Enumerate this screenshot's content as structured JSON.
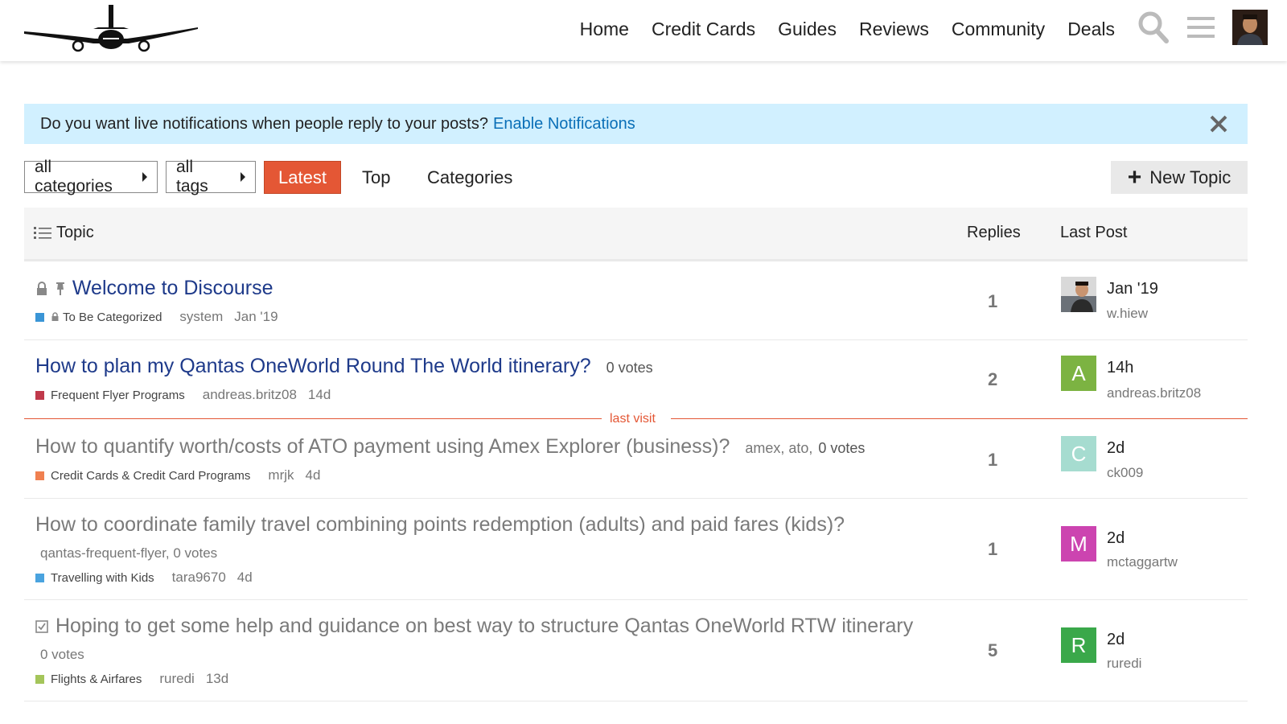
{
  "header": {
    "nav": [
      "Home",
      "Credit Cards",
      "Guides",
      "Reviews",
      "Community",
      "Deals"
    ],
    "icons": [
      "search-icon",
      "hamburger-menu-icon",
      "user-avatar"
    ]
  },
  "banner": {
    "text": "Do you want live notifications when people reply to your posts?",
    "link": "Enable Notifications"
  },
  "filters": {
    "categories": "all categories",
    "tags": "all tags",
    "tabs": [
      "Latest",
      "Top",
      "Categories"
    ],
    "active_tab": "Latest",
    "new_topic": "New Topic"
  },
  "table": {
    "headers": {
      "topic": "Topic",
      "replies": "Replies",
      "last_post": "Last Post"
    },
    "last_visit_label": "last visit",
    "rows": [
      {
        "title": "Welcome to Discourse",
        "locked": true,
        "pinned": true,
        "read": false,
        "category": "To Be Categorized",
        "category_color": "#3a95d6",
        "category_locked": true,
        "poster": "system",
        "age": "Jan '19",
        "replies": "1",
        "last_time": "Jan '19",
        "last_user": "w.hiew",
        "last_avatar_letter": "",
        "last_avatar_color": "#5a4a40"
      },
      {
        "title": "How to plan my Qantas OneWorld Round The World itinerary?",
        "votes": "0 votes",
        "read": false,
        "category": "Frequent Flyer Programs",
        "category_color": "#c0394b",
        "poster": "andreas.britz08",
        "age": "14d",
        "replies": "2",
        "last_time": "14h",
        "last_user": "andreas.britz08",
        "last_avatar_letter": "A",
        "last_avatar_color": "#7cb342"
      },
      {
        "title": "How to quantify worth/costs of ATO payment using Amex Explorer (business)?",
        "tags_inline": "amex, ato, ",
        "votes": "0 votes",
        "read": true,
        "category": "Credit Cards & Credit Card Programs",
        "category_color": "#f08050",
        "poster": "mrjk",
        "age": "4d",
        "replies": "1",
        "last_time": "2d",
        "last_user": "ck009",
        "last_avatar_letter": "C",
        "last_avatar_color": "#a6dcd0"
      },
      {
        "title": "How to coordinate family travel combining points redemption (adults) and paid fares (kids)?",
        "tags_line": "qantas-frequent-flyer, 0 votes",
        "read": true,
        "category": "Travelling with Kids",
        "category_color": "#4aa3df",
        "poster": "tara9670",
        "age": "4d",
        "replies": "1",
        "last_time": "2d",
        "last_user": "mctaggartw",
        "last_avatar_letter": "M",
        "last_avatar_color": "#cc44b0"
      },
      {
        "title": "Hoping to get some help and guidance on best way to structure Qantas OneWorld RTW itinerary",
        "solved": true,
        "tags_line": "0 votes",
        "read": true,
        "category": "Flights & Airfares",
        "category_color": "#a4c55a",
        "poster": "ruredi",
        "age": "13d",
        "replies": "5",
        "last_time": "2d",
        "last_user": "ruredi",
        "last_avatar_letter": "R",
        "last_avatar_color": "#3aa84a"
      }
    ]
  }
}
